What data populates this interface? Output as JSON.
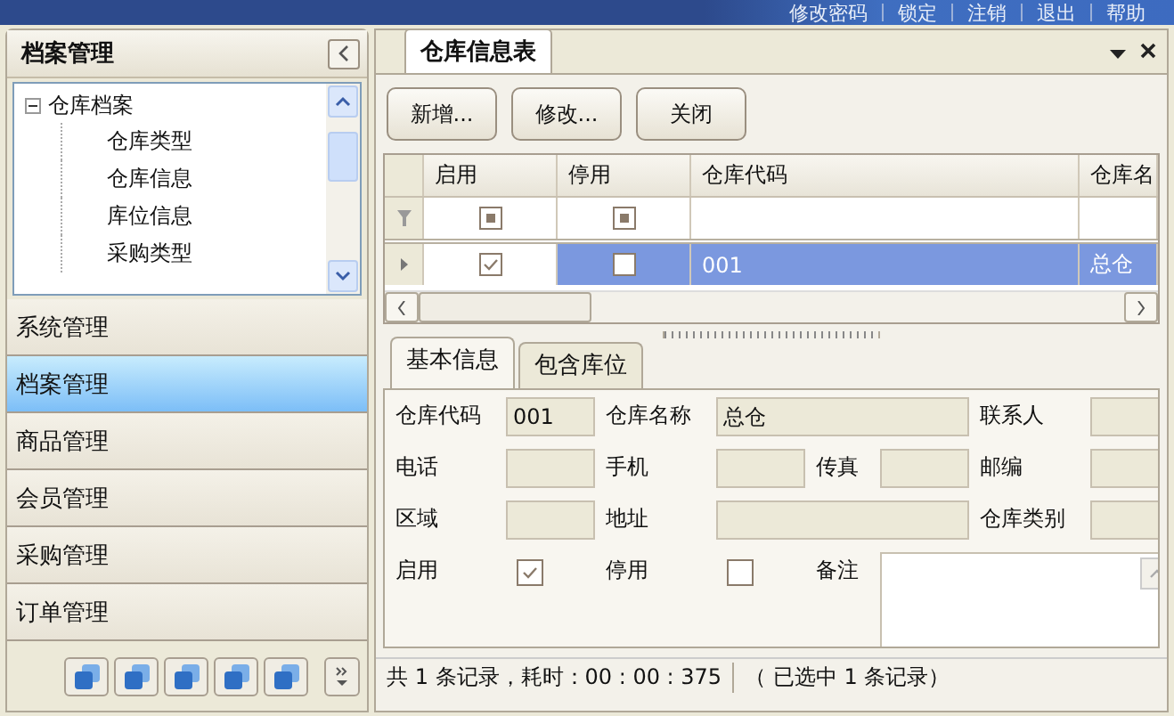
{
  "top_menu": [
    "修改密码",
    "锁定",
    "注销",
    "退出",
    "帮助"
  ],
  "sidebar": {
    "title": "档案管理",
    "tree": [
      {
        "label": "仓库档案",
        "expanded": true,
        "children": [
          {
            "label": "仓库类型"
          },
          {
            "label": "仓库信息"
          },
          {
            "label": "库位信息"
          },
          {
            "label": "采购类型"
          }
        ]
      }
    ],
    "nav": [
      {
        "label": "系统管理",
        "selected": false
      },
      {
        "label": "档案管理",
        "selected": true
      },
      {
        "label": "商品管理",
        "selected": false
      },
      {
        "label": "会员管理",
        "selected": false
      },
      {
        "label": "采购管理",
        "selected": false
      },
      {
        "label": "订单管理",
        "selected": false
      }
    ]
  },
  "document_tab": {
    "title": "仓库信息表"
  },
  "toolbar": [
    "新增...",
    "修改...",
    "关闭"
  ],
  "grid": {
    "columns": [
      "启用",
      "停用",
      "仓库代码",
      "仓库名"
    ],
    "rows": [
      {
        "kind": "filter",
        "enabled": null,
        "disabled": null,
        "selected": false
      },
      {
        "kind": "data",
        "enabled": true,
        "disabled": false,
        "code": "001",
        "name": "总仓",
        "selected": true
      }
    ]
  },
  "detail_tabs": [
    {
      "label": "基本信息",
      "selected": true
    },
    {
      "label": "包含库位",
      "selected": false
    }
  ],
  "form": [
    {
      "label": "仓库代码",
      "kind": "text",
      "value": "001"
    },
    {
      "label": "仓库名称",
      "kind": "wide",
      "value": "总仓"
    },
    {
      "label": "联系人",
      "kind": "text"
    },
    {
      "label": "电话",
      "kind": "text"
    },
    {
      "label": "手机",
      "kind": "text"
    },
    {
      "label": "传真",
      "kind": "text"
    },
    {
      "label": "邮编",
      "kind": "text"
    },
    {
      "label": "区域",
      "kind": "text"
    },
    {
      "label": "地址",
      "kind": "wide"
    },
    {
      "label": "仓库类别",
      "kind": "text"
    },
    {
      "label": "启用",
      "kind": "checkbox",
      "checked": true
    },
    {
      "label": "停用",
      "kind": "checkbox",
      "checked": false
    },
    {
      "label": "备注",
      "kind": "memo"
    }
  ],
  "status_bar": {
    "summary": "共 1 条记录，耗时：00 : 00 : 375",
    "selection": "（ 已选中 1 条记录）"
  }
}
